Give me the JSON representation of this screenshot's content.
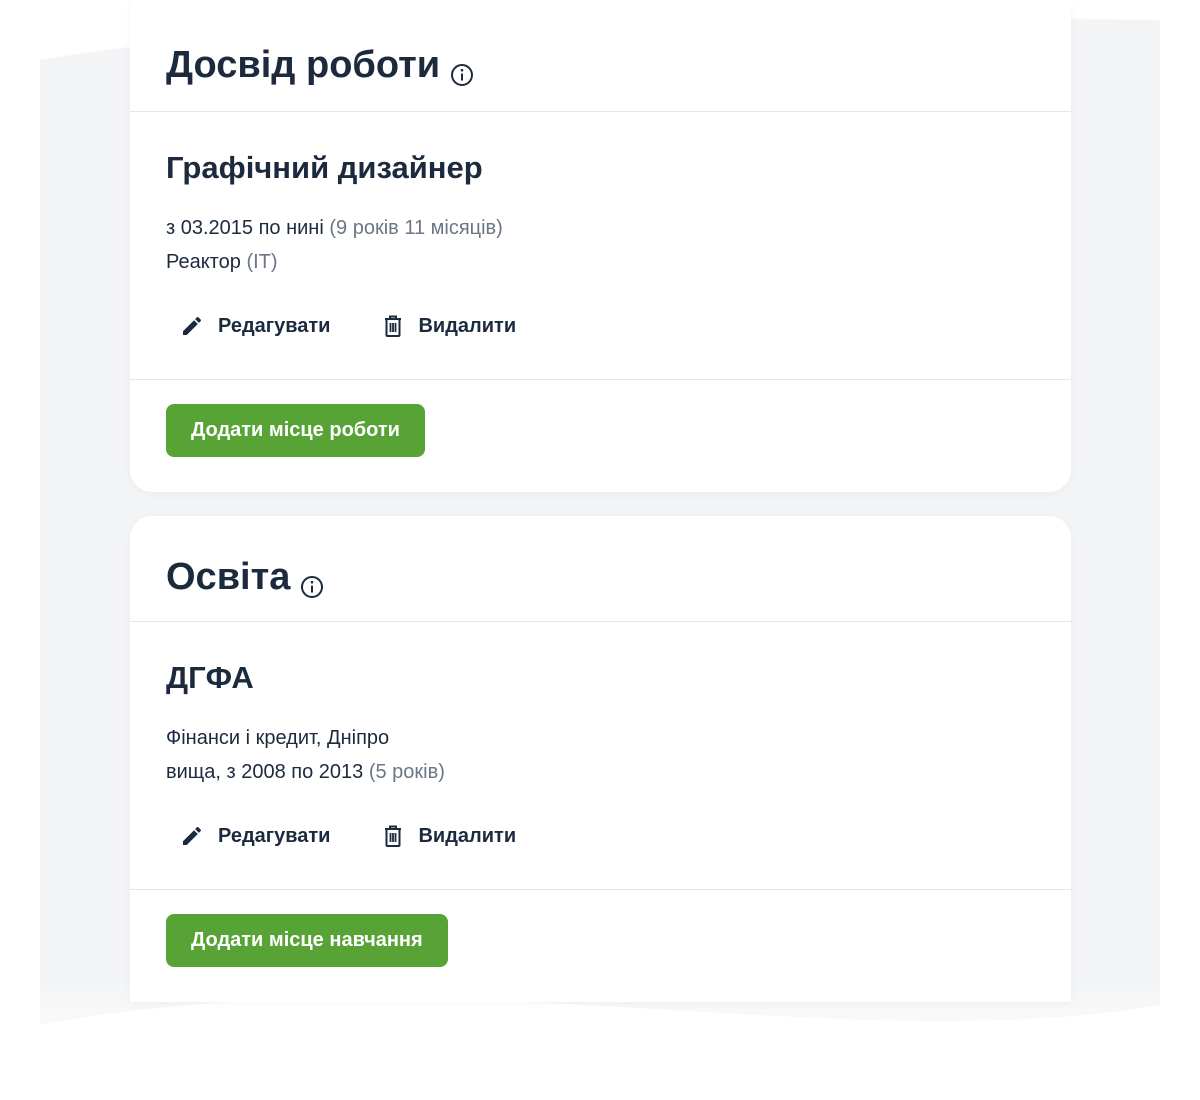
{
  "work": {
    "title": "Досвід роботи",
    "info_icon": "info-circle-icon",
    "entry": {
      "title": "Графічний дизайнер",
      "period": "з 03.2015 по нині",
      "duration": "(9 років 11 місяців)",
      "company": "Реактор",
      "industry": "(IT)"
    },
    "edit_label": "Редагувати",
    "delete_label": "Видалити",
    "add_label": "Додати місце роботи"
  },
  "education": {
    "title": "Освіта",
    "info_icon": "info-circle-icon",
    "entry": {
      "title": "ДГФА",
      "details": "Фінанси і кредит, Дніпро",
      "level_period": "вища, з 2008 по 2013",
      "duration": "(5 років)"
    },
    "edit_label": "Редагувати",
    "delete_label": "Видалити",
    "add_label": "Додати місце навчання"
  },
  "colors": {
    "accent_green": "#58a336",
    "text_dark": "#1c2a3e",
    "text_muted": "#6b7686",
    "divider": "#e3e6ea",
    "background": "#f3f4f5"
  }
}
